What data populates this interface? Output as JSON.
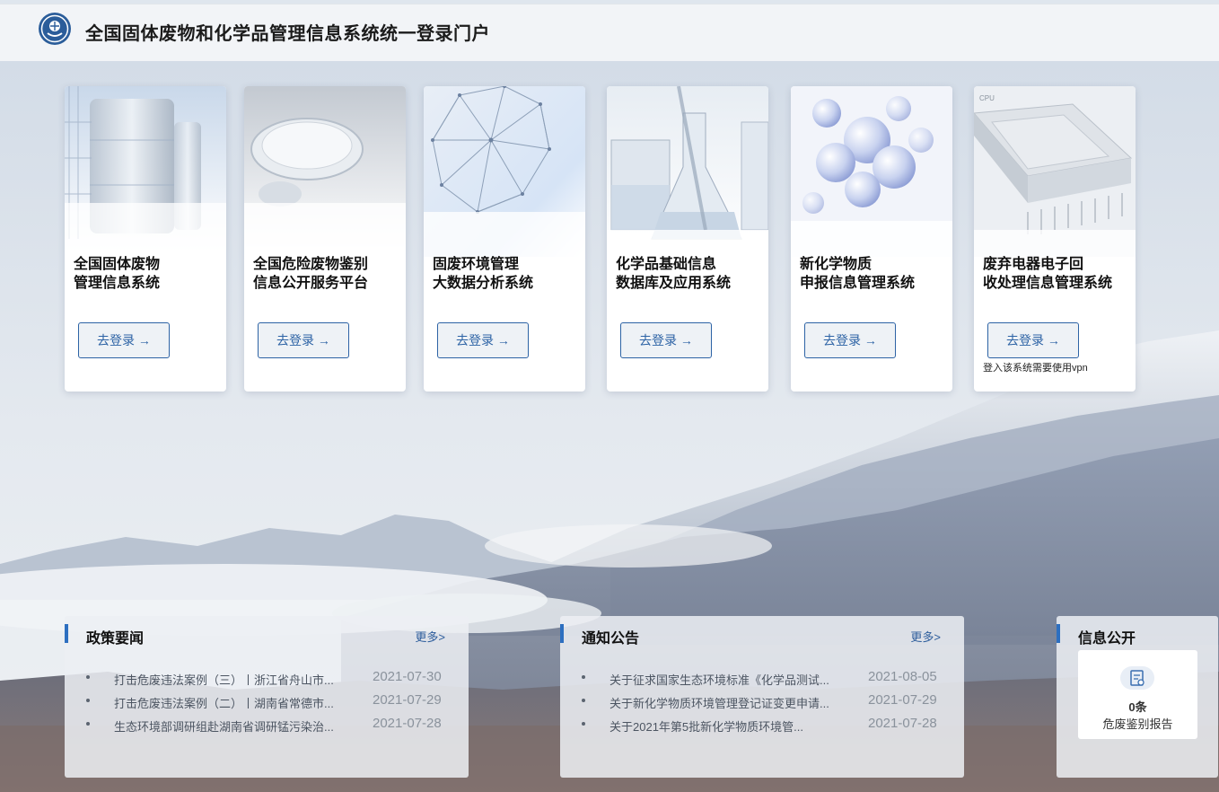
{
  "header": {
    "title": "全国固体废物和化学品管理信息系统统一登录门户"
  },
  "cards": [
    {
      "line1": "全国固体废物",
      "line2": "管理信息系统",
      "button": "去登录 →",
      "note": ""
    },
    {
      "line1": "全国危险废物鉴别",
      "line2": "信息公开服务平台",
      "button": "去登录 →",
      "note": ""
    },
    {
      "line1": "固废环境管理",
      "line2": "大数据分析系统",
      "button": "去登录 →",
      "note": ""
    },
    {
      "line1": "化学品基础信息",
      "line2": "数据库及应用系统",
      "button": "去登录 →",
      "note": ""
    },
    {
      "line1": "新化学物质",
      "line2": "申报信息管理系统",
      "button": "去登录 →",
      "note": ""
    },
    {
      "line1": "废弃电器电子回",
      "line2": "收处理信息管理系统",
      "button": "去登录 →",
      "note": "登入该系统需要使用vpn"
    }
  ],
  "policy": {
    "title": "政策要闻",
    "more": "更多>",
    "items": [
      {
        "title": "打击危废违法案例（三）丨浙江省舟山市...",
        "date": "2021-07-30"
      },
      {
        "title": "打击危废违法案例（二）丨湖南省常德市...",
        "date": "2021-07-29"
      },
      {
        "title": "生态环境部调研组赴湖南省调研锰污染治...",
        "date": "2021-07-28"
      }
    ]
  },
  "notice": {
    "title": "通知公告",
    "more": "更多>",
    "items": [
      {
        "title": "关于征求国家生态环境标准《化学品测试...",
        "date": "2021-08-05"
      },
      {
        "title": "关于新化学物质环境管理登记证变更申请...",
        "date": "2021-07-29"
      },
      {
        "title": "关于2021年第5批新化学物质环境管...",
        "date": "2021-07-28"
      }
    ]
  },
  "disclosure": {
    "title": "信息公开",
    "count": "0条",
    "label": "危废鉴别报告"
  },
  "icons": {
    "emblem": "national-emblem-icon",
    "report": "report-document-icon",
    "arrow": "arrow-right-icon"
  },
  "colors": {
    "accent": "#2d63a5",
    "panel_bar": "#2d6fc0",
    "header_bg": "#f2f4f7"
  }
}
